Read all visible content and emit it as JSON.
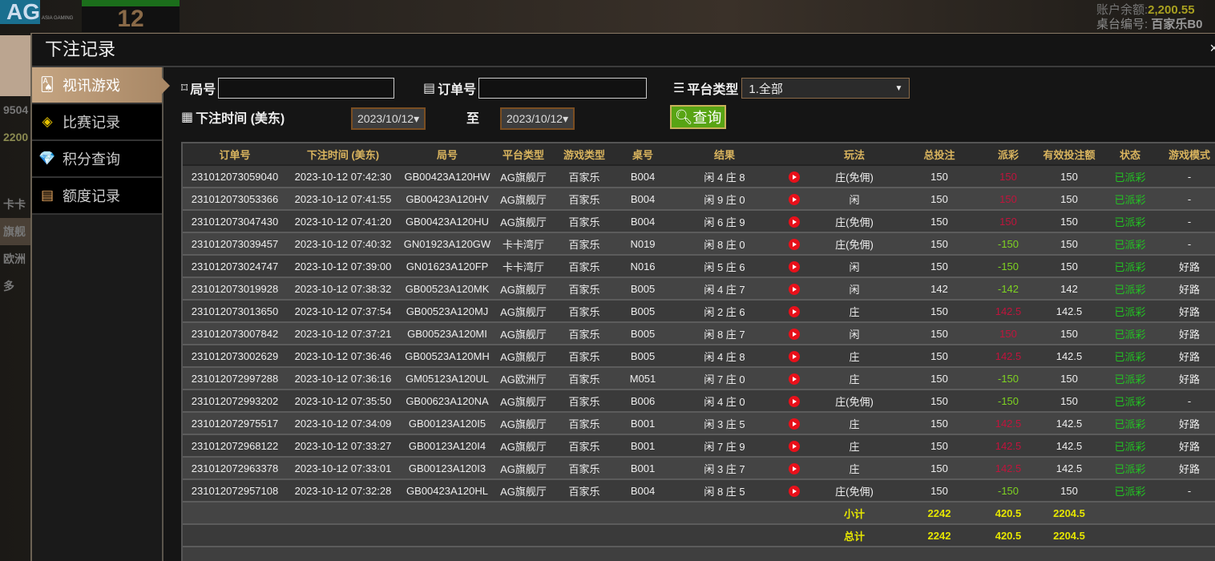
{
  "background": {
    "logo": "AG",
    "logo_sub": "ASIA GAMING",
    "round_number": "12",
    "balance_label": "账户余额:",
    "balance_value": "2,200.55",
    "table_label": "桌台编号:",
    "table_value": "百家乐B0",
    "left_values": [
      "9504",
      "2200"
    ],
    "left_tabs": [
      "卡卡",
      "旗舰",
      "欧洲",
      "多"
    ]
  },
  "modal": {
    "title": "下注记录",
    "close": "×"
  },
  "sidebar": {
    "items": [
      {
        "label": "视讯游戏",
        "icon": "playing-cards-icon",
        "active": true
      },
      {
        "label": "比赛记录",
        "icon": "ticket-icon"
      },
      {
        "label": "积分查询",
        "icon": "diamond-icon"
      },
      {
        "label": "额度记录",
        "icon": "document-icon"
      }
    ]
  },
  "filters": {
    "round_label": "局号",
    "round_value": "",
    "order_label": "订单号",
    "order_value": "",
    "platform_label": "平台类型",
    "platform_value": "1.全部",
    "time_label": "下注时间 (美东)",
    "date_from": "2023/10/12▾",
    "to_label": "至",
    "date_to": "2023/10/12▾",
    "query_label": "查询"
  },
  "table": {
    "columns": [
      "订单号",
      "下注时间 (美东)",
      "局号",
      "平台类型",
      "游戏类型",
      "桌号",
      "结果",
      "",
      "玩法",
      "总投注",
      "派彩",
      "有效投注额",
      "状态",
      "游戏模式"
    ],
    "rows": [
      [
        "231012073059040",
        "2023-10-12 07:42:30",
        "GB00423A120HW",
        "AG旗舰厅",
        "百家乐",
        "B004",
        "闲 4 庄 8",
        "庄(免佣)",
        "150",
        "150",
        "150",
        "已派彩",
        "-"
      ],
      [
        "231012073053366",
        "2023-10-12 07:41:55",
        "GB00423A120HV",
        "AG旗舰厅",
        "百家乐",
        "B004",
        "闲 9 庄 0",
        "闲",
        "150",
        "150",
        "150",
        "已派彩",
        "-"
      ],
      [
        "231012073047430",
        "2023-10-12 07:41:20",
        "GB00423A120HU",
        "AG旗舰厅",
        "百家乐",
        "B004",
        "闲 6 庄 9",
        "庄(免佣)",
        "150",
        "150",
        "150",
        "已派彩",
        "-"
      ],
      [
        "231012073039457",
        "2023-10-12 07:40:32",
        "GN01923A120GW",
        "卡卡湾厅",
        "百家乐",
        "N019",
        "闲 8 庄 0",
        "庄(免佣)",
        "150",
        "-150",
        "150",
        "已派彩",
        "-"
      ],
      [
        "231012073024747",
        "2023-10-12 07:39:00",
        "GN01623A120FP",
        "卡卡湾厅",
        "百家乐",
        "N016",
        "闲 5 庄 6",
        "闲",
        "150",
        "-150",
        "150",
        "已派彩",
        "好路"
      ],
      [
        "231012073019928",
        "2023-10-12 07:38:32",
        "GB00523A120MK",
        "AG旗舰厅",
        "百家乐",
        "B005",
        "闲 4 庄 7",
        "闲",
        "142",
        "-142",
        "142",
        "已派彩",
        "好路"
      ],
      [
        "231012073013650",
        "2023-10-12 07:37:54",
        "GB00523A120MJ",
        "AG旗舰厅",
        "百家乐",
        "B005",
        "闲 2 庄 6",
        "庄",
        "150",
        "142.5",
        "142.5",
        "已派彩",
        "好路"
      ],
      [
        "231012073007842",
        "2023-10-12 07:37:21",
        "GB00523A120MI",
        "AG旗舰厅",
        "百家乐",
        "B005",
        "闲 8 庄 7",
        "闲",
        "150",
        "150",
        "150",
        "已派彩",
        "好路"
      ],
      [
        "231012073002629",
        "2023-10-12 07:36:46",
        "GB00523A120MH",
        "AG旗舰厅",
        "百家乐",
        "B005",
        "闲 4 庄 8",
        "庄",
        "150",
        "142.5",
        "142.5",
        "已派彩",
        "好路"
      ],
      [
        "231012072997288",
        "2023-10-12 07:36:16",
        "GM05123A120UL",
        "AG欧洲厅",
        "百家乐",
        "M051",
        "闲 7 庄 0",
        "庄",
        "150",
        "-150",
        "150",
        "已派彩",
        "好路"
      ],
      [
        "231012072993202",
        "2023-10-12 07:35:50",
        "GB00623A120NA",
        "AG旗舰厅",
        "百家乐",
        "B006",
        "闲 4 庄 0",
        "庄(免佣)",
        "150",
        "-150",
        "150",
        "已派彩",
        "-"
      ],
      [
        "231012072975517",
        "2023-10-12 07:34:09",
        "GB00123A120I5",
        "AG旗舰厅",
        "百家乐",
        "B001",
        "闲 3 庄 5",
        "庄",
        "150",
        "142.5",
        "142.5",
        "已派彩",
        "好路"
      ],
      [
        "231012072968122",
        "2023-10-12 07:33:27",
        "GB00123A120I4",
        "AG旗舰厅",
        "百家乐",
        "B001",
        "闲 7 庄 9",
        "庄",
        "150",
        "142.5",
        "142.5",
        "已派彩",
        "好路"
      ],
      [
        "231012072963378",
        "2023-10-12 07:33:01",
        "GB00123A120I3",
        "AG旗舰厅",
        "百家乐",
        "B001",
        "闲 3 庄 7",
        "庄",
        "150",
        "142.5",
        "142.5",
        "已派彩",
        "好路"
      ],
      [
        "231012072957108",
        "2023-10-12 07:32:28",
        "GB00423A120HL",
        "AG旗舰厅",
        "百家乐",
        "B004",
        "闲 8 庄 5",
        "庄(免佣)",
        "150",
        "-150",
        "150",
        "已派彩",
        "-"
      ]
    ],
    "subtotal": {
      "label": "小计",
      "total_bet": "2242",
      "payout": "420.5",
      "valid_bet": "2204.5"
    },
    "total": {
      "label": "总计",
      "total_bet": "2242",
      "payout": "420.5",
      "valid_bet": "2204.5"
    }
  },
  "colors": {
    "win_payout": "#c0143c",
    "loss_payout": "#7ed321",
    "status": "#22c322",
    "totals": "#e6e600",
    "header_text": "#d9b45e",
    "query_button": "#58a414"
  }
}
